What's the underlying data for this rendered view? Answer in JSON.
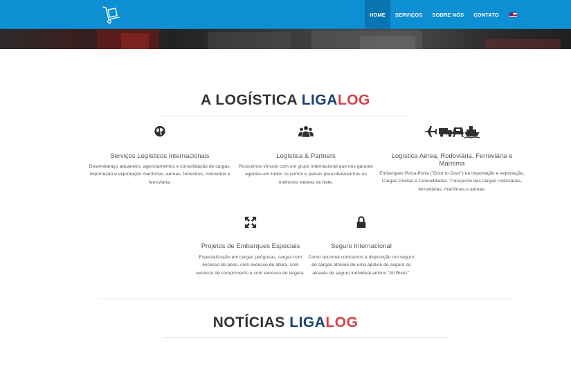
{
  "nav": {
    "items": [
      {
        "label": "HOME",
        "active": true
      },
      {
        "label": "SERVIÇOS",
        "active": false
      },
      {
        "label": "SOBRE NÓS",
        "active": false
      },
      {
        "label": "CONTATO",
        "active": false
      }
    ],
    "flag_icon": "us-flag-icon",
    "logo_icon": "hand-truck-icon"
  },
  "colors": {
    "nav_bg": "#0c8fd3",
    "nav_active": "#0875b0",
    "brand_blue": "#1b3f7a",
    "brand_red": "#d6424a"
  },
  "section_logistica": {
    "title_prefix": "A LOGÍSTICA",
    "brand_liga": "LIGA",
    "brand_log": "LOG"
  },
  "features": [
    {
      "icon": "globe-icon",
      "title": "Serviços Logísticos Internacionais",
      "text": "Desembaraço aduaneiro, agenciamentos e consolidação de cargas, importação e exportação marítimas, aéreas, terrestres, rodoviária e ferroviária."
    },
    {
      "icon": "users-icon",
      "title": "Logística & Partners",
      "text": "Possuímos vínculo com um grupo internacional que nos garante agentes em todos os portos e países para oferecermos os melhores valores de frete."
    },
    {
      "icon": "transport-icons",
      "title": "Logística Aérea, Rodoviária, Ferroviária e Marítima",
      "text": "Embarques Porta-Porta (\"Door to Door\") na importação e exportação, Cargas Diretas e Consolidadas. Transporte das cargas rodoviárias, ferroviárias, marítimas e aéreas."
    },
    {
      "icon": "arrows-expand-icon",
      "title": "Projetos de Embarques Especiais",
      "text": "Especialização em cargas perigosas, cargas com excesso de peso, com excesso de altura, com excesso de comprimento e com excesso de largura."
    },
    {
      "icon": "lock-icon",
      "title": "Seguro Internacional",
      "text": "Como opcional colocamos à disposição um seguro de cargas através de uma apólice de seguro ou através de seguro individual ambos \"All Risks\"."
    }
  ],
  "section_noticias": {
    "title_prefix": "NOTÍCIAS",
    "brand_liga": "LIGA",
    "brand_log": "LOG"
  }
}
